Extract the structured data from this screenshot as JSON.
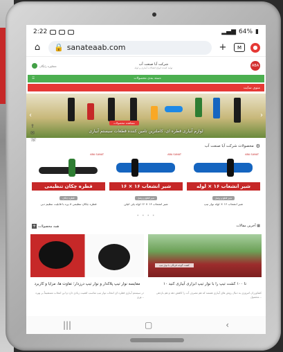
{
  "status_bar": {
    "time": "2:22",
    "battery": "64%"
  },
  "browser": {
    "url": "sanateaab.com",
    "tab_count": "M"
  },
  "site": {
    "logo_name": "شرکت آبا صنعت آب",
    "logo_tag": "تولید کننده انواع اتصالات آبیاری و لوله",
    "top_badge": "مشاوره رایگان",
    "green_nav_label": "دسته بندی محصولات",
    "red_nav_label": "منوی سایت"
  },
  "banner": {
    "title": "لوازم آبیاری قطره ای، کاملترین تامین کننده قطعات سیستم آبیاری",
    "cta": "مشاهده محصولات"
  },
  "products_section": {
    "title": "محصولات شرکت آبا صنعت آب",
    "items": [
      {
        "strip": "شیر انشعاب ۱۶ × لوله",
        "brand": "ABA SANAT",
        "category": "شیر قطع و وصل",
        "name": "شیر انشعاب ۱۶ × لوله نوار تیپ"
      },
      {
        "strip": "شیر انشعاب ۱۶ × ۱۶",
        "brand": "ABA SANAT",
        "category": "شیر قطع و وصل",
        "name": "شیر انشعاب ۱۶ × ۱۶ لوله پلی اتیلن"
      },
      {
        "strip": "قطره چکان تنظیمی",
        "brand": "ABA SANAT",
        "category": "قطره چکان",
        "name": "قطره چکان تنظیمی ۸ پره با قابلیت تنظیم دبی"
      }
    ],
    "dots": "• • • •"
  },
  "lower": {
    "articles_title": "آخرین مقالات",
    "more_products": "همه محصولات"
  },
  "articles": [
    {
      "title": "مقایسه نوار تیپ پلاکدار و نوار تیپ درزدار؛ تفاوت ها، مزایا و کاربرد",
      "text": "در سیستم آبیاری قطره ای انتخاب نوار تیپ مناسب اهمیت زیادی دارد و این انتخاب مستقیماً بر بهره وری..."
    },
    {
      "title": "۱۰ تا ۱۰۰ کشت تیپ را با نوار تیپ ابزاری آبیاری کنید",
      "text": "کشاورزان امروزی به دنبال روش های آبیاری هستند که هم مصرف آب را کاهش دهد و هم بازدهی محصول...",
      "image_label": "کشت گوجه فرنگی با نوار تیپ"
    }
  ],
  "icons": {
    "lock": "lock-icon",
    "home": "home-icon",
    "plus": "plus-icon",
    "menu": "menu-icon"
  },
  "colors": {
    "accent_red": "#e53935",
    "accent_green": "#4caf50",
    "link_blue": "#1565c0"
  }
}
